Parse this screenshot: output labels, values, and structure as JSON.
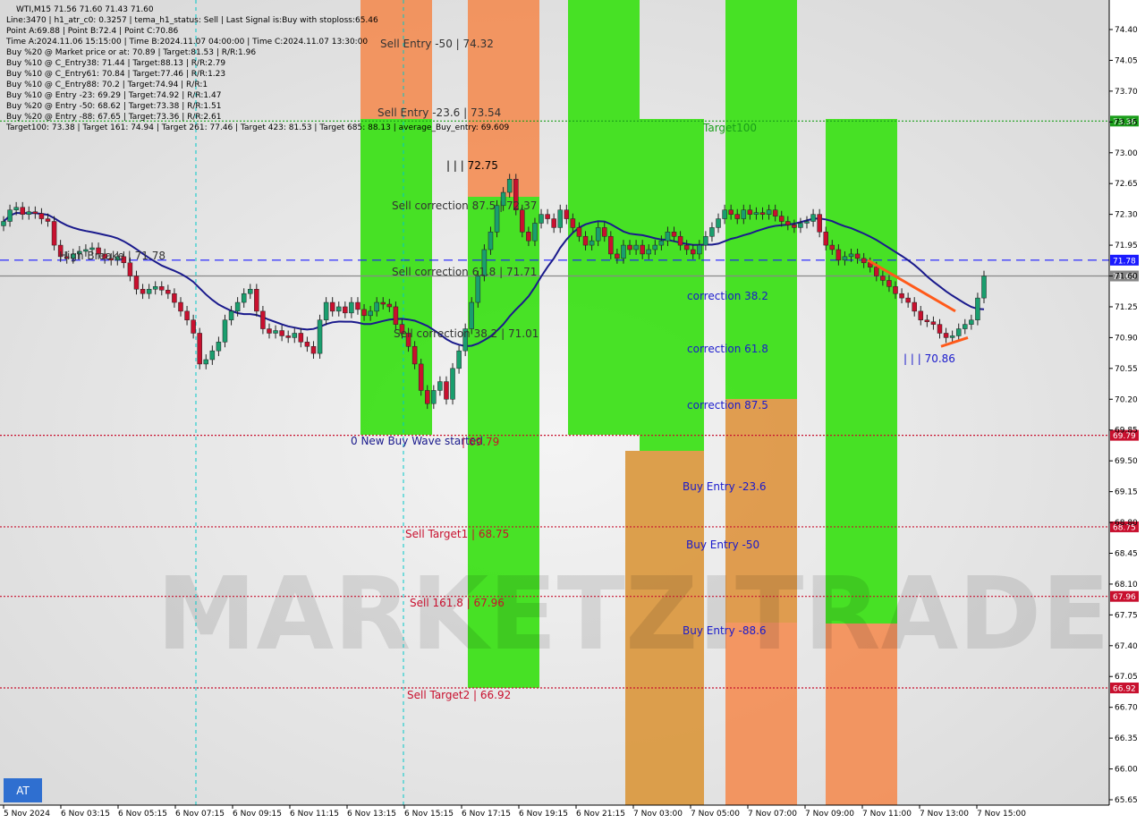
{
  "info_lines": [
    "WTI,M15  71.56 71.60 71.43 71.60",
    "Line:3470  |  h1_atr_c0: 0.3257  |  tema_h1_status: Sell  |  Last Signal is:Buy with stoploss:65.46",
    "Point A:69.88  |  Point B:72.4  |  Point C:70.86",
    "Time A:2024.11.06 15:15:00  |  Time B:2024.11.07 04:00:00  |  Time C:2024.11.07 13:30:00",
    "Buy %20 @ Market price or at: 70.89  |  Target:81.53  |  R/R:1.96",
    "Buy %10 @ C_Entry38: 71.44  |  Target:88.13  |  R/R:2.79",
    "Buy %10 @ C_Entry61: 70.84  |  Target:77.46  |  R/R:1.23",
    "Buy %10 @ C_Entry88: 70.2  |  Target:74.94  |  R/R:1",
    "Buy %10 @ Entry -23: 69.29  |  Target:74.92  |  R/R:1.47",
    "Buy %20 @ Entry -50: 68.62  |  Target:73.38  |  R/R:1.51",
    "Buy %20 @ Entry -88: 67.65  |  Target:73.36  |  R/R:2.61",
    "Target100: 73.38  |  Target 161: 74.94  |  Target 261: 77.46  |  Target 423: 81.53  |  Target 685: 88.13  |  average_Buy_entry: 69.609"
  ],
  "watermark": "MARKETZITRADE",
  "at_button": "AT",
  "colors": {
    "green_zone": "#3ee01a",
    "orange_zone": "#f4874a",
    "olive_zone": "#c8a53a",
    "bull": "#1a9e6e",
    "bear": "#c8102e",
    "ma": "#1a1a8c",
    "dashed_blue": "#1a1aff",
    "red_level": "#c8102e",
    "green_level": "#1a9e1a"
  },
  "zones": [
    {
      "label": "Sell Entry -50 | 74.32",
      "label_color": "#333333"
    },
    {
      "label": "Sell Entry -23.6 | 73.54",
      "label_color": "#333333"
    },
    {
      "label": "| | | 72.75",
      "label_color": "#000000"
    },
    {
      "label": "Sell correction 87.5 | 72.37",
      "label_color": "#333333"
    },
    {
      "label": "Sell correction 61.8 | 71.71",
      "label_color": "#333333"
    },
    {
      "label": "Sell correction 38.2 | 71.01",
      "label_color": "#333333"
    },
    {
      "label": "0 New Buy Wave started",
      "label_color": "#1a1a8c"
    },
    {
      "label": "| 69.79",
      "label_color": "#c8102e"
    },
    {
      "label": "Sell Target1 | 68.75",
      "label_color": "#c8102e"
    },
    {
      "label": "Sell 161.8 | 67.96",
      "label_color": "#c8102e"
    },
    {
      "label": "Sell Target2 | 66.92",
      "label_color": "#c8102e"
    },
    {
      "label": "correction 38.2",
      "label_color": "#1a1acc"
    },
    {
      "label": "correction 61.8",
      "label_color": "#1a1acc"
    },
    {
      "label": "correction 87.5",
      "label_color": "#1a1acc"
    },
    {
      "label": "Buy Entry -23.6",
      "label_color": "#1a1acc"
    },
    {
      "label": "Buy Entry -50",
      "label_color": "#1a1acc"
    },
    {
      "label": "Buy Entry -88.6",
      "label_color": "#1a1acc"
    },
    {
      "label": "Target100",
      "label_color": "#1a9e1a"
    },
    {
      "label": "| | | 70.86",
      "label_color": "#1a1acc"
    },
    {
      "label": "High Breake | 71.78",
      "label_color": "#333333"
    }
  ],
  "chart_data": {
    "type": "candlestick",
    "symbol": "WTI",
    "timeframe": "M15",
    "ohlc_last": {
      "open": 71.56,
      "high": 71.6,
      "low": 71.43,
      "close": 71.6
    },
    "y_ticks": [
      "74.40",
      "74.05",
      "73.70",
      "73.35",
      "73.00",
      "72.65",
      "72.30",
      "71.95",
      "71.60",
      "71.25",
      "70.90",
      "70.55",
      "70.20",
      "69.85",
      "69.50",
      "69.15",
      "68.80",
      "68.45",
      "68.10",
      "67.75",
      "67.40",
      "67.05",
      "66.70",
      "66.35",
      "66.00",
      "65.65"
    ],
    "ylim": [
      65.65,
      74.4
    ],
    "x_ticks": [
      "5 Nov 2024",
      "6 Nov 03:15",
      "6 Nov 05:15",
      "6 Nov 07:15",
      "6 Nov 09:15",
      "6 Nov 11:15",
      "6 Nov 13:15",
      "6 Nov 15:15",
      "6 Nov 17:15",
      "6 Nov 19:15",
      "6 Nov 21:15",
      "7 Nov 03:00",
      "7 Nov 05:00",
      "7 Nov 07:00",
      "7 Nov 09:00",
      "7 Nov 11:00",
      "7 Nov 13:00",
      "7 Nov 15:00"
    ],
    "levels": [
      {
        "value": 73.36,
        "label": "73.36",
        "color": "#1a9e1a",
        "style": "dotted"
      },
      {
        "value": 71.78,
        "label": "71.78",
        "color": "#1a1aff",
        "style": "dashed"
      },
      {
        "value": 71.6,
        "label": "71.60",
        "color": "#888888",
        "style": "solid"
      },
      {
        "value": 69.79,
        "label": "69.79",
        "color": "#c8102e",
        "style": "dotted"
      },
      {
        "value": 68.75,
        "label": "68.75",
        "color": "#c8102e",
        "style": "dotted"
      },
      {
        "value": 67.96,
        "label": "67.96",
        "color": "#c8102e",
        "style": "dotted"
      },
      {
        "value": 66.92,
        "label": "66.92",
        "color": "#c8102e",
        "style": "dotted"
      }
    ],
    "closes": [
      72.22,
      72.35,
      72.38,
      72.3,
      72.33,
      72.31,
      72.25,
      72.22,
      71.95,
      71.82,
      71.8,
      71.85,
      71.88,
      71.9,
      71.92,
      71.85,
      71.8,
      71.78,
      71.82,
      71.75,
      71.6,
      71.45,
      71.4,
      71.45,
      71.48,
      71.44,
      71.4,
      71.3,
      71.2,
      71.1,
      70.95,
      70.6,
      70.65,
      70.75,
      70.85,
      71.1,
      71.2,
      71.3,
      71.4,
      71.45,
      71.2,
      71.0,
      70.95,
      70.98,
      70.92,
      70.9,
      70.95,
      70.85,
      70.8,
      70.72,
      71.1,
      71.3,
      71.2,
      71.25,
      71.18,
      71.3,
      71.22,
      71.15,
      71.2,
      71.3,
      71.28,
      71.25,
      71.05,
      70.95,
      70.8,
      70.6,
      70.3,
      70.15,
      70.3,
      70.4,
      70.2,
      70.55,
      70.75,
      71.0,
      71.3,
      71.6,
      71.9,
      72.1,
      72.4,
      72.55,
      72.7,
      72.35,
      72.1,
      72.0,
      72.2,
      72.3,
      72.25,
      72.15,
      72.35,
      72.25,
      72.15,
      72.05,
      71.95,
      72.0,
      72.15,
      72.05,
      71.85,
      71.8,
      71.95,
      71.9,
      71.95,
      71.85,
      71.9,
      71.95,
      72.0,
      72.1,
      72.05,
      71.95,
      71.9,
      71.85,
      71.95,
      72.05,
      72.15,
      72.25,
      72.35,
      72.3,
      72.25,
      72.35,
      72.3,
      72.32,
      72.3,
      72.35,
      72.28,
      72.22,
      72.18,
      72.15,
      72.2,
      72.22,
      72.3,
      72.1,
      71.95,
      71.9,
      71.78,
      71.82,
      71.85,
      71.8,
      71.75,
      71.7,
      71.6,
      71.55,
      71.48,
      71.4,
      71.35,
      71.3,
      71.2,
      71.1,
      71.08,
      71.05,
      70.95,
      70.9,
      70.92,
      71.0,
      71.05,
      71.1,
      71.35,
      71.6
    ]
  }
}
